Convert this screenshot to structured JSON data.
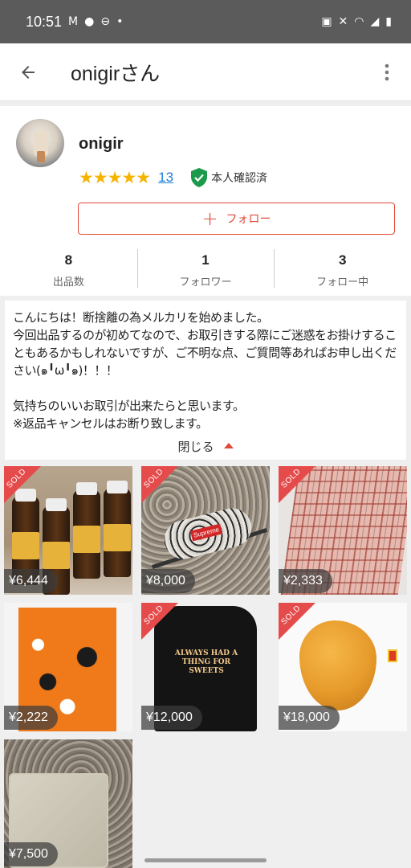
{
  "status_bar": {
    "time": "10:51",
    "icons_left": [
      "gmail-icon",
      "drop-icon",
      "dnd-icon",
      "dot-icon"
    ],
    "icons_right": [
      "battery-saver-icon",
      "mute-icon",
      "wifi-icon",
      "signal-icon",
      "battery-icon"
    ]
  },
  "app_bar": {
    "title": "onigirさん",
    "back_icon": "arrow-back-icon",
    "more_icon": "more-vert-icon"
  },
  "profile": {
    "username": "onigir",
    "rating_stars": 5,
    "review_count": "13",
    "verified_label": "本人確認済",
    "follow_label": "フォロー",
    "stats": [
      {
        "value": "8",
        "label": "出品数"
      },
      {
        "value": "1",
        "label": "フォロワー"
      },
      {
        "value": "3",
        "label": "フォロー中"
      }
    ]
  },
  "bio": {
    "text": "こんにちは！断捨離の為メルカリを始めました。\n今回出品するのが初めてなので、お取引きする際にご迷惑をお掛けすることもあるかもしれないですが、ご不明な点、ご質問等あればお申し出ください(๑╹ω╹๑)！！！\n\n気持ちのいいお取引が出来たらと思います。\n※返品キャンセルはお断り致します。",
    "close_label": "閉じる"
  },
  "items": [
    {
      "price": "¥6,444",
      "sold": true,
      "sold_label": "SOLD",
      "photo": "bottles"
    },
    {
      "price": "¥8,000",
      "sold": true,
      "sold_label": "SOLD",
      "photo": "bag"
    },
    {
      "price": "¥2,333",
      "sold": true,
      "sold_label": "SOLD",
      "photo": "plaid"
    },
    {
      "price": "¥2,222",
      "sold": false,
      "photo": "shirt"
    },
    {
      "price": "¥12,000",
      "sold": true,
      "sold_label": "SOLD",
      "photo": "hoodie",
      "photo_text": "ALWAYS HAD A THING FOR SWEETS"
    },
    {
      "price": "¥18,000",
      "sold": true,
      "sold_label": "SOLD",
      "photo": "nugget"
    },
    {
      "price": "¥7,500",
      "sold": false,
      "photo": "wallet"
    }
  ],
  "colors": {
    "accent": "#e0483a",
    "star": "#f5b400",
    "link": "#1e7fd6",
    "verified": "#1a9a4a",
    "sold_ribbon": "#e54b4b"
  }
}
